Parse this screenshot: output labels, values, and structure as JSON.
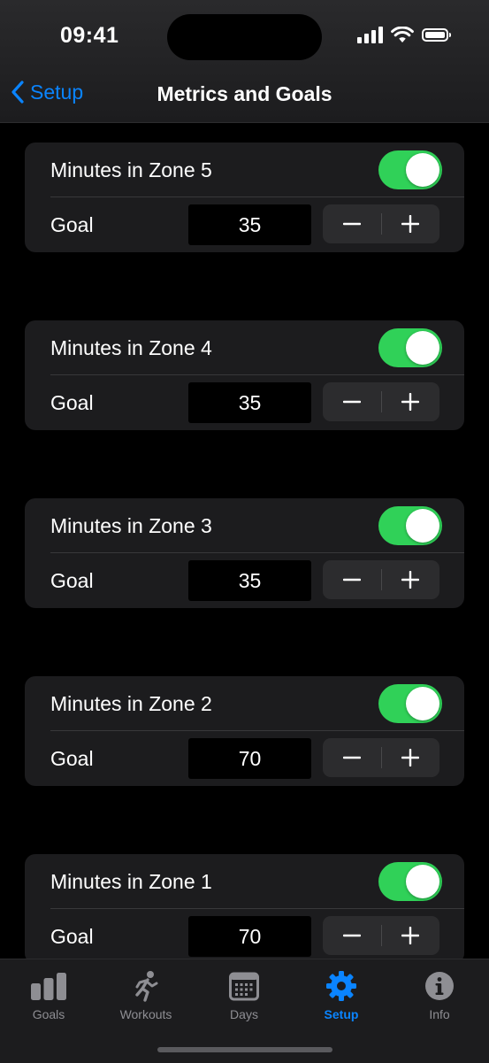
{
  "status_bar": {
    "time": "09:41"
  },
  "nav": {
    "back_label": "Setup",
    "title": "Metrics and Goals"
  },
  "colors": {
    "accent": "#0a84ff",
    "toggle_on": "#30d158",
    "card_bg": "#1c1c1e",
    "inactive_tab": "#8e8e93"
  },
  "metrics": [
    {
      "label": "Minutes in Zone 5",
      "enabled": true,
      "goal_label": "Goal",
      "goal_value": "35"
    },
    {
      "label": "Minutes in Zone 4",
      "enabled": true,
      "goal_label": "Goal",
      "goal_value": "35"
    },
    {
      "label": "Minutes in Zone 3",
      "enabled": true,
      "goal_label": "Goal",
      "goal_value": "35"
    },
    {
      "label": "Minutes in Zone 2",
      "enabled": true,
      "goal_label": "Goal",
      "goal_value": "70"
    },
    {
      "label": "Minutes in Zone 1",
      "enabled": true,
      "goal_label": "Goal",
      "goal_value": "70"
    }
  ],
  "tabs": [
    {
      "label": "Goals",
      "icon": "bar-chart-icon",
      "active": false
    },
    {
      "label": "Workouts",
      "icon": "running-figure-icon",
      "active": false
    },
    {
      "label": "Days",
      "icon": "calendar-icon",
      "active": false
    },
    {
      "label": "Setup",
      "icon": "gear-icon",
      "active": true
    },
    {
      "label": "Info",
      "icon": "info-icon",
      "active": false
    }
  ]
}
